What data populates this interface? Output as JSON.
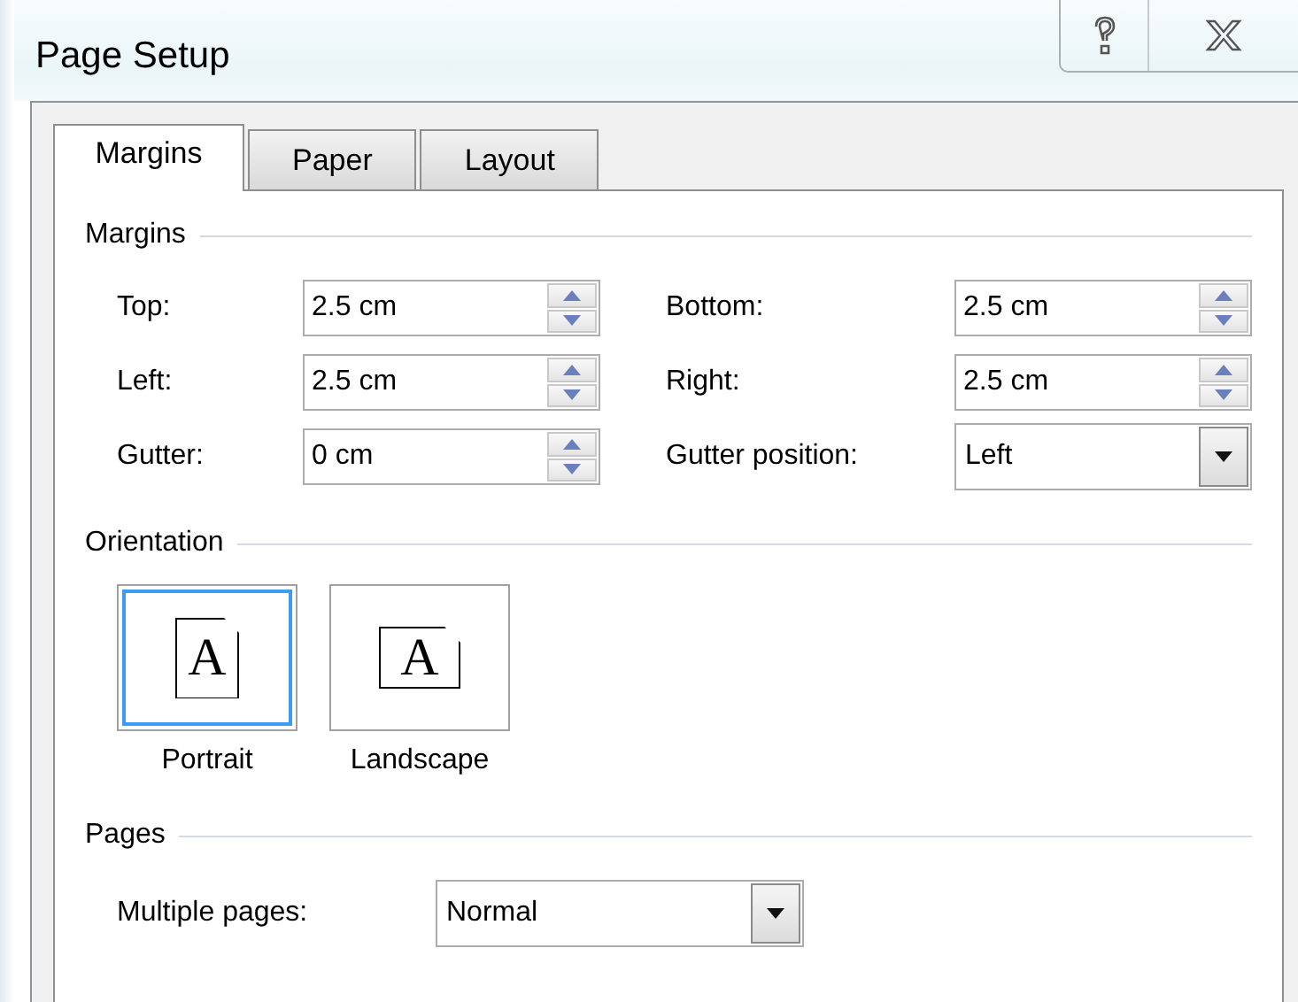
{
  "window": {
    "title": "Page Setup"
  },
  "tabs": [
    {
      "label": "Margins",
      "selected": true
    },
    {
      "label": "Paper",
      "selected": false
    },
    {
      "label": "Layout",
      "selected": false
    }
  ],
  "margins": {
    "title": "Margins",
    "fields": [
      {
        "label": "Top:",
        "value": "2.5 cm",
        "kind": "spinner"
      },
      {
        "label": "Bottom:",
        "value": "2.5 cm",
        "kind": "spinner"
      },
      {
        "label": "Left:",
        "value": "2.5 cm",
        "kind": "spinner"
      },
      {
        "label": "Right:",
        "value": "2.5 cm",
        "kind": "spinner"
      },
      {
        "label": "Gutter:",
        "value": "0 cm",
        "kind": "spinner"
      },
      {
        "label": "Gutter position:",
        "value": "Left",
        "kind": "dropdown"
      }
    ]
  },
  "orientation": {
    "title": "Orientation",
    "options": [
      {
        "label": "Portrait",
        "glyph": "A",
        "kind": "portrait",
        "selected": true
      },
      {
        "label": "Landscape",
        "glyph": "A",
        "kind": "landscape",
        "selected": false
      }
    ]
  },
  "pages": {
    "title": "Pages",
    "fields": [
      {
        "label": "Multiple pages:",
        "value": "Normal",
        "kind": "dropdown"
      }
    ]
  }
}
